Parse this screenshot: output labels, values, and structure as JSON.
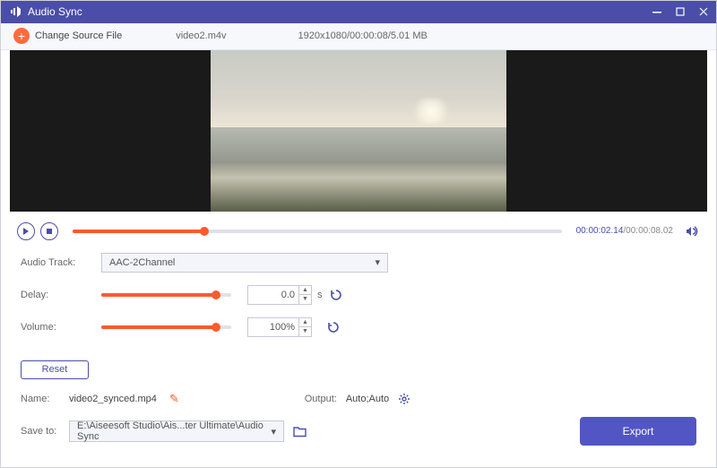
{
  "title": "Audio Sync",
  "toolbar": {
    "change_label": "Change Source File",
    "filename": "video2.m4v",
    "meta": "1920x1080/00:00:08/5.01 MB"
  },
  "playback": {
    "current": "00:00:02.14",
    "total": "/00:00:08.02",
    "progress_pct": 27
  },
  "settings": {
    "audio_track_label": "Audio Track:",
    "audio_track_value": "AAC-2Channel",
    "delay_label": "Delay:",
    "delay_value": "0.0",
    "delay_unit": "s",
    "delay_pct": 88,
    "volume_label": "Volume:",
    "volume_value": "100%",
    "volume_pct": 88,
    "reset_label": "Reset"
  },
  "output": {
    "name_label": "Name:",
    "name_value": "video2_synced.mp4",
    "output_label": "Output:",
    "output_value": "Auto;Auto",
    "save_label": "Save to:",
    "save_value": "E:\\Aiseesoft Studio\\Ais...ter Ultimate\\Audio Sync",
    "export_label": "Export"
  }
}
